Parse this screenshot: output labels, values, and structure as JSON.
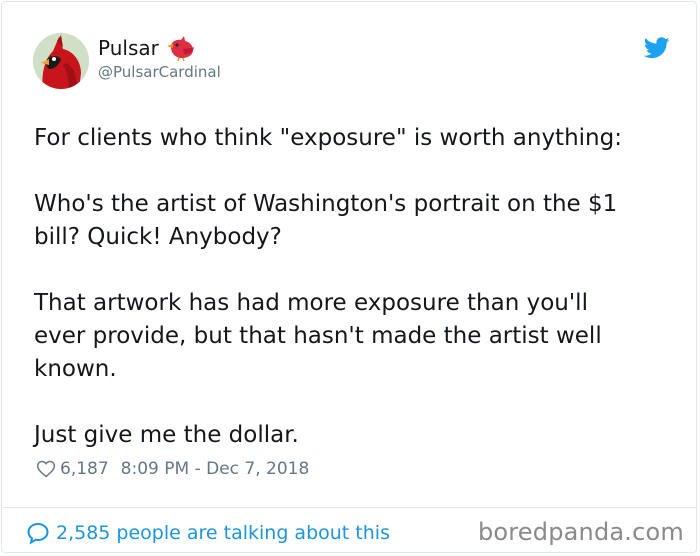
{
  "user": {
    "display_name": "Pulsar",
    "handle": "@PulsarCardinal",
    "avatar_icon": "cardinal-bird-avatar",
    "name_emoji_icon": "red-bird-icon"
  },
  "header": {
    "logo_icon": "twitter-bird-icon",
    "logo_color": "#1da1f2"
  },
  "tweet": {
    "paragraphs": [
      "For clients who think \"exposure\" is worth anything:",
      "Who's the artist of Washington's portrait on the $1\nbill? Quick! Anybody?",
      "That artwork has had more exposure than you'll\never provide, but that hasn't made the artist well\nknown.",
      "Just give me the dollar."
    ]
  },
  "meta": {
    "like_icon": "heart-icon",
    "like_count": "6,187",
    "timestamp": "8:09 PM - Dec 7, 2018"
  },
  "footer": {
    "talking_icon": "speech-bubble-icon",
    "talking_text": "2,585 people are talking about this",
    "link_color": "#1b95e0"
  },
  "watermark": {
    "text": "boredpanda.com"
  }
}
